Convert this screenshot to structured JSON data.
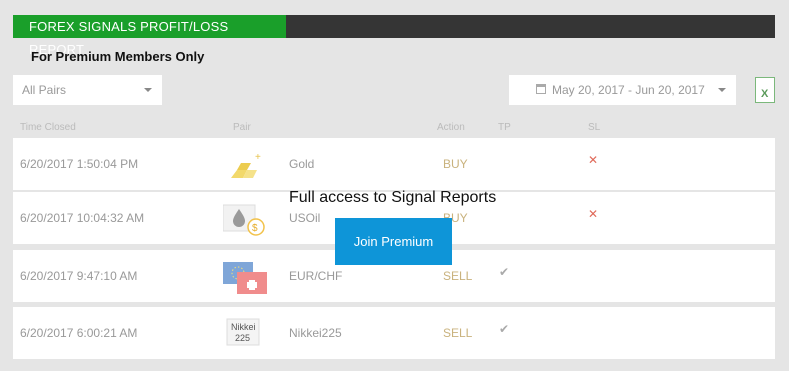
{
  "header": {
    "title": "FOREX SIGNALS PROFIT/LOSS REPORT"
  },
  "subtitle": "For Premium Members Only",
  "filters": {
    "pairs_selected": "All Pairs",
    "date_range": "May 20, 2017 - Jun 20, 2017"
  },
  "table": {
    "columns": [
      "Time Closed",
      "Pair",
      "Action",
      "TP",
      "SL"
    ],
    "rows": [
      {
        "time": "6/20/2017 1:50:04 PM",
        "pair": "Gold",
        "action": "BUY",
        "tp": "",
        "sl": "✕",
        "icon": "gold-bars-icon"
      },
      {
        "time": "6/20/2017 10:04:32 AM",
        "pair": "USOil",
        "action": "BUY",
        "tp": "",
        "sl": "✕",
        "icon": "oil-drop-icon"
      },
      {
        "time": "6/20/2017 9:47:10 AM",
        "pair": "EUR/CHF",
        "action": "SELL",
        "tp": "✔",
        "sl": "",
        "icon": "eur-chf-flags-icon"
      },
      {
        "time": "6/20/2017 6:00:21 AM",
        "pair": "Nikkei225",
        "action": "SELL",
        "tp": "✔",
        "sl": "",
        "icon": "nikkei-icon"
      }
    ]
  },
  "overlay": {
    "message": "Full access to Signal Reports",
    "button_label": "Join Premium"
  },
  "icons": {
    "nikkei_label_1": "Nikkei",
    "nikkei_label_2": "225"
  },
  "colors": {
    "header_tab": "#1a9f2a",
    "header_bar": "#353535",
    "button": "#0e95d8",
    "sl_x": "#e06a5a"
  }
}
